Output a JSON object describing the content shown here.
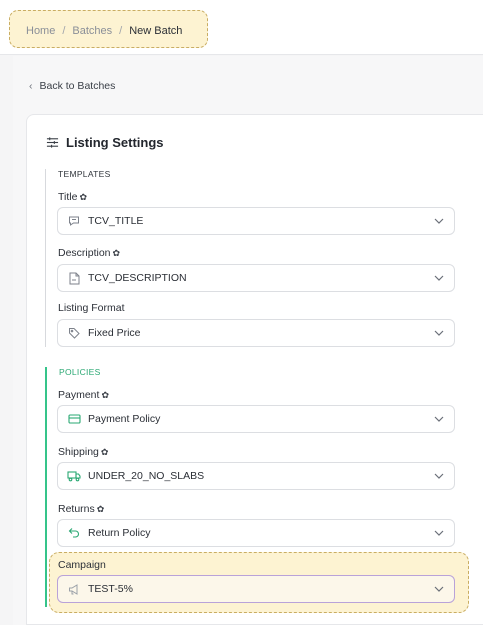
{
  "breadcrumb": {
    "items": [
      "Home",
      "Batches",
      "New Batch"
    ],
    "separator": "/"
  },
  "back_link": {
    "icon": "chevron-left-icon",
    "label": "Back to Batches"
  },
  "listing_settings": {
    "title": "Listing Settings",
    "title_icon": "sliders-icon",
    "templates": {
      "label": "TEMPLATES",
      "fields": [
        {
          "label": "Title",
          "has_settings": true,
          "icon": "message-square-icon",
          "value": "TCV_TITLE"
        },
        {
          "label": "Description",
          "has_settings": true,
          "icon": "file-text-icon",
          "value": "TCV_DESCRIPTION"
        },
        {
          "label": "Listing Format",
          "has_settings": false,
          "icon": "tag-icon",
          "value": "Fixed Price"
        }
      ]
    },
    "policies": {
      "label": "POLICIES",
      "accent_color": "#35c48a",
      "fields": [
        {
          "label": "Payment",
          "has_settings": true,
          "icon": "credit-card-icon",
          "value": "Payment Policy"
        },
        {
          "label": "Shipping",
          "has_settings": true,
          "icon": "truck-icon",
          "value": "UNDER_20_NO_SLABS"
        },
        {
          "label": "Returns",
          "has_settings": true,
          "icon": "return-arrow-icon",
          "value": "Return Policy"
        },
        {
          "label": "Campaign",
          "has_settings": false,
          "icon": "megaphone-icon",
          "value": "TEST-5%"
        }
      ]
    }
  },
  "colors": {
    "highlight_fill": "#fdf3d2",
    "highlight_border": "#c9ad63",
    "policy_icon": "#2aa873",
    "focus_border": "#b9a2d9"
  }
}
